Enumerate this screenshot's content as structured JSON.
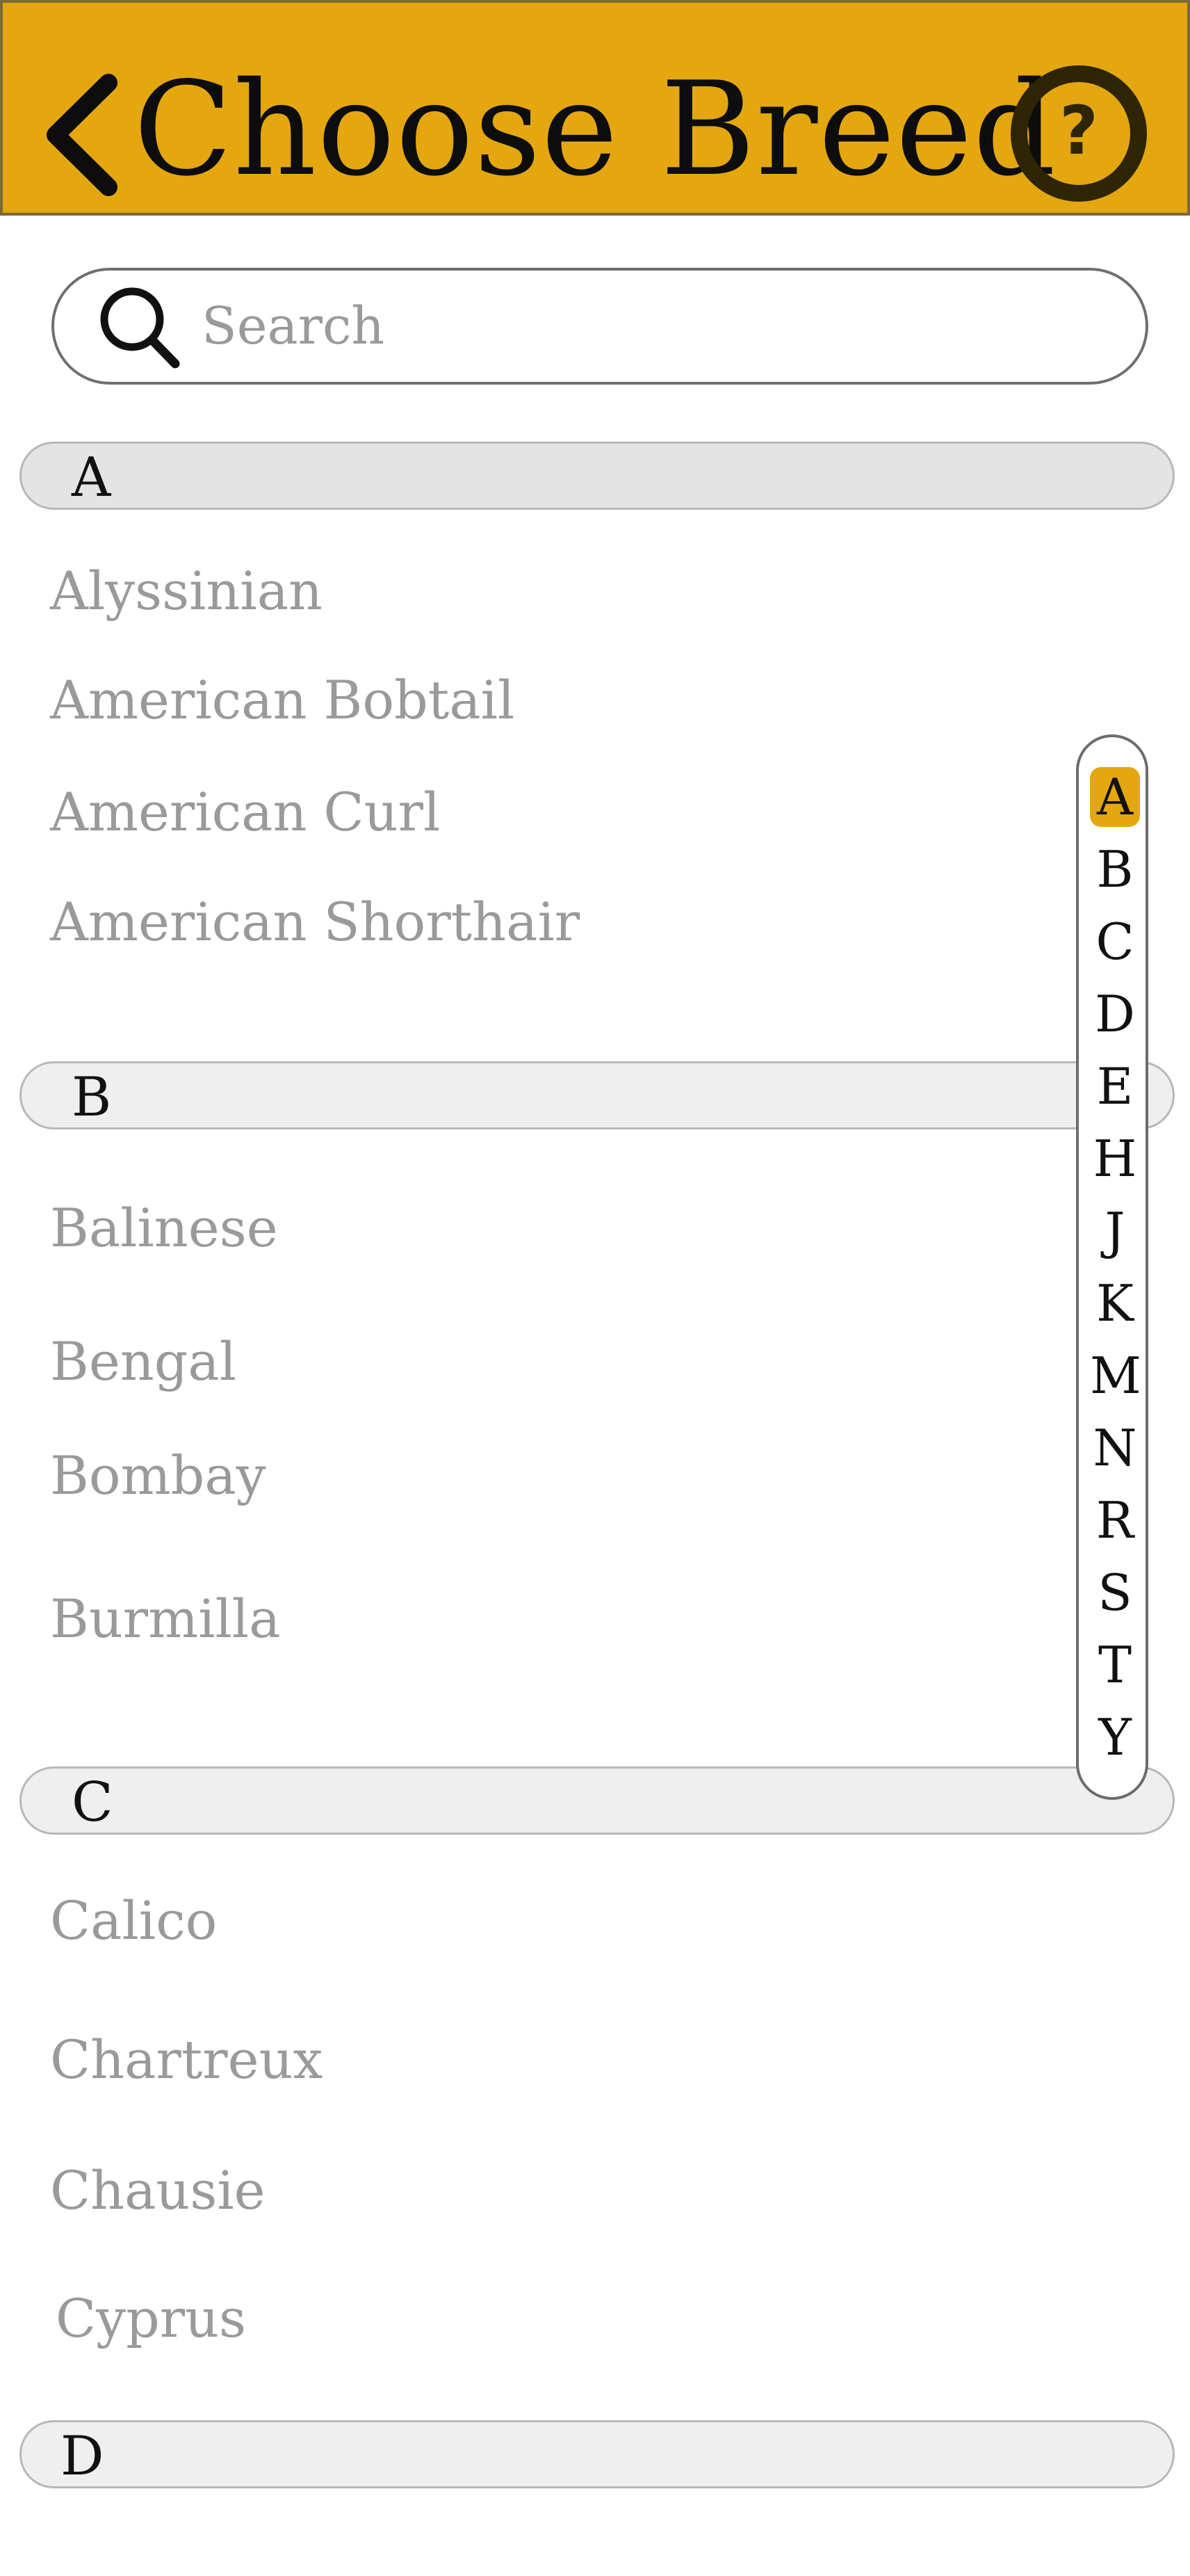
{
  "header": {
    "title": "Choose Breed",
    "back_icon": "chevron-left-icon",
    "help_icon": "question-circle-icon",
    "background_color": "#E4A710"
  },
  "search": {
    "placeholder": "Search",
    "value": "",
    "icon": "search-icon"
  },
  "sections": [
    {
      "letter": "A",
      "breeds": [
        "Alyssinian",
        "American Bobtail",
        "American Curl",
        "American Shorthair"
      ]
    },
    {
      "letter": "B",
      "breeds": [
        "Balinese",
        "Bengal",
        "Bombay",
        "Burmilla"
      ]
    },
    {
      "letter": "C",
      "breeds": [
        "Calico",
        "Chartreux",
        "Chausie",
        "Cyprus"
      ]
    },
    {
      "letter": "D",
      "breeds": []
    }
  ],
  "index_bar": {
    "letters": [
      "A",
      "B",
      "C",
      "D",
      "E",
      "H",
      "J",
      "K",
      "M",
      "N",
      "R",
      "S",
      "T",
      "Y"
    ],
    "active": "A",
    "active_color": "#E4A710"
  }
}
